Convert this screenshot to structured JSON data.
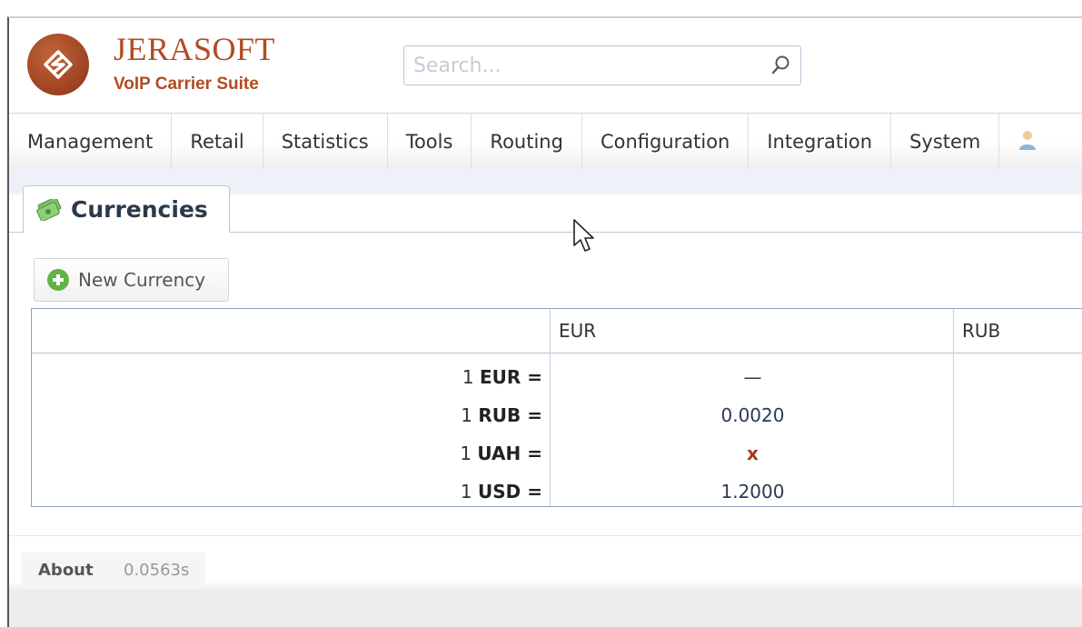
{
  "brand": {
    "title": "JERASOFT",
    "subtitle": "VoIP Carrier Suite",
    "color": "#b24b23"
  },
  "search": {
    "placeholder": "Search..."
  },
  "menu": [
    {
      "label": "Management"
    },
    {
      "label": "Retail"
    },
    {
      "label": "Statistics"
    },
    {
      "label": "Tools"
    },
    {
      "label": "Routing"
    },
    {
      "label": "Configuration"
    },
    {
      "label": "Integration"
    },
    {
      "label": "System"
    }
  ],
  "tab": {
    "label": "Currencies",
    "icon": "money-icon"
  },
  "toolbar": {
    "new_label": "New Currency"
  },
  "table": {
    "columns": [
      "EUR",
      "RUB"
    ],
    "rows": [
      {
        "prefix": "1 ",
        "code": "EUR",
        "suffix": " =",
        "eur": "—",
        "eur_type": "dash"
      },
      {
        "prefix": "1 ",
        "code": "RUB",
        "suffix": " =",
        "eur": "0.0020",
        "eur_type": "value"
      },
      {
        "prefix": "1 ",
        "code": "UAH",
        "suffix": " =",
        "eur": "x",
        "eur_type": "missing"
      },
      {
        "prefix": "1 ",
        "code": "USD",
        "suffix": " =",
        "eur": "1.2000",
        "eur_type": "value"
      }
    ]
  },
  "footer": {
    "about_label": "About",
    "time_label": "0.0563s"
  }
}
